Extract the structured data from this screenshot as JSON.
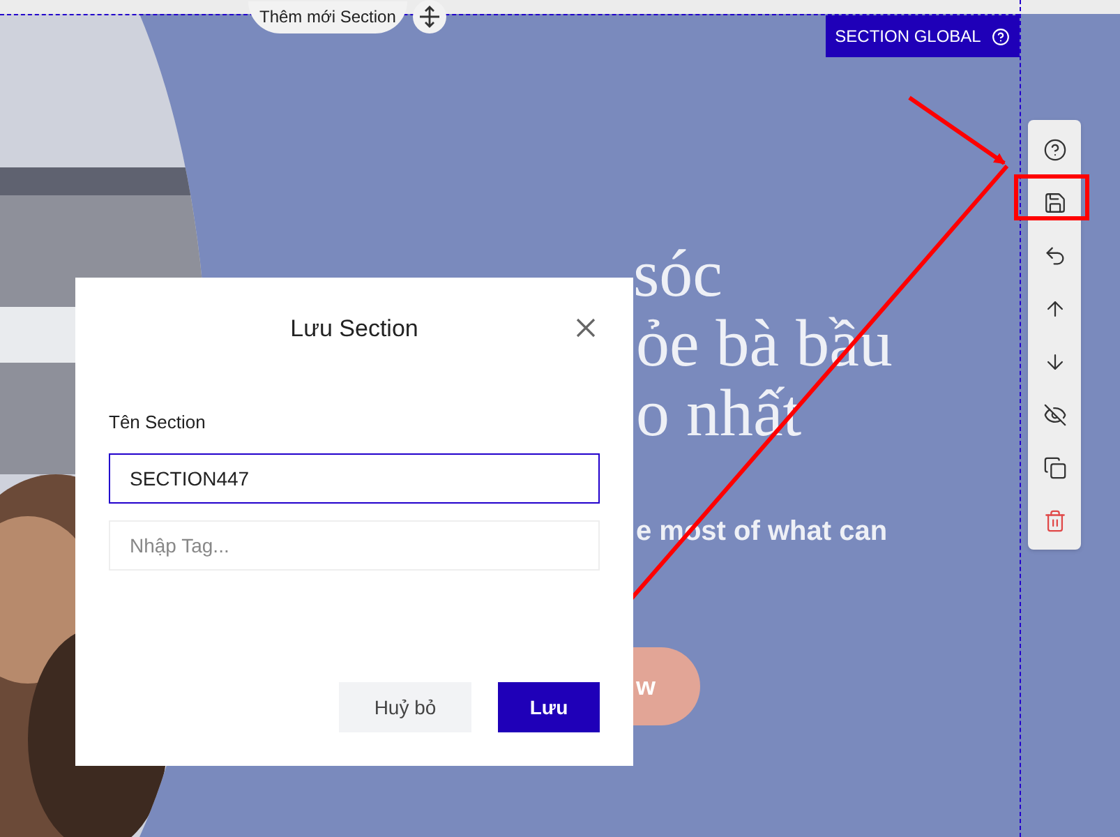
{
  "add_section": {
    "label": "Thêm mới Section"
  },
  "section_badge": {
    "label": "SECTION GLOBAL"
  },
  "hero": {
    "heading_lines": [
      "sóc",
      "ỏe bà bầu",
      "o nhất"
    ],
    "subtitle": "e most of what can",
    "cta": "w"
  },
  "dialog": {
    "title": "Lưu Section",
    "name_label": "Tên Section",
    "name_value": "SECTION447",
    "tag_placeholder": "Nhập Tag...",
    "cancel": "Huỷ bỏ",
    "save": "Lưu"
  },
  "toolbar": [
    {
      "kind": "help",
      "highlighted": false
    },
    {
      "kind": "save",
      "highlighted": true
    },
    {
      "kind": "undo",
      "highlighted": false
    },
    {
      "kind": "up",
      "highlighted": false
    },
    {
      "kind": "down",
      "highlighted": false
    },
    {
      "kind": "hide",
      "highlighted": false
    },
    {
      "kind": "copy",
      "highlighted": false
    },
    {
      "kind": "delete",
      "highlighted": false
    }
  ]
}
